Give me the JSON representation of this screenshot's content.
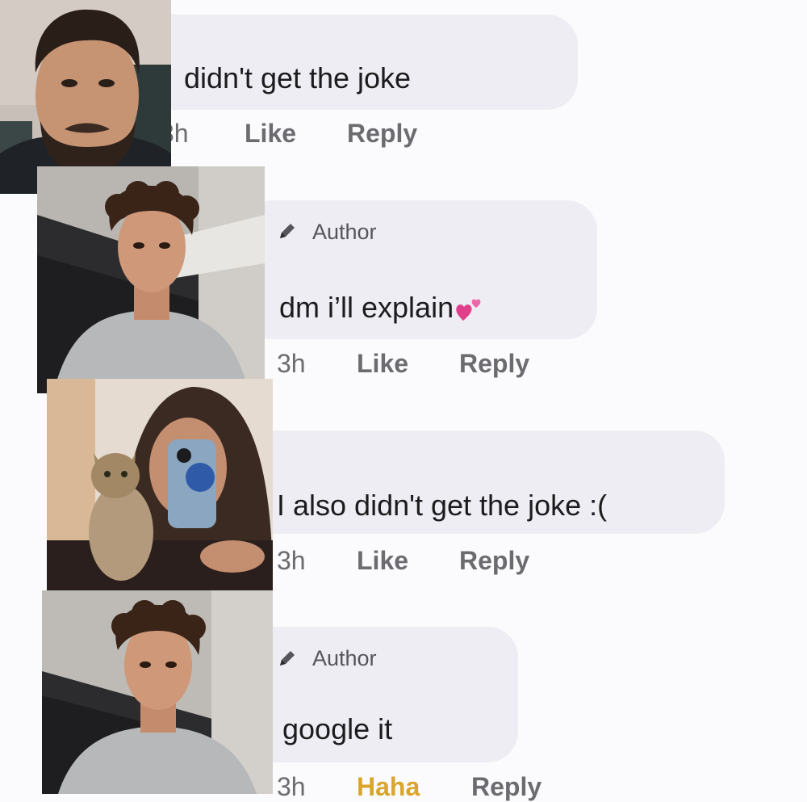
{
  "comments": [
    {
      "text": "didn't get the joke",
      "time": "3h",
      "actions": [
        "Like",
        "Reply"
      ],
      "is_author": false
    },
    {
      "text": "dm i’ll explain",
      "emoji": "two-hearts",
      "time": "3h",
      "actions": [
        "Like",
        "Reply"
      ],
      "is_author": true,
      "badge": "Author"
    },
    {
      "text": "I also didn't get the joke :(",
      "time": "3h",
      "actions": [
        "Like",
        "Reply"
      ],
      "is_author": false
    },
    {
      "text": "google it",
      "time": "3h",
      "actions": [
        "Haha",
        "Reply"
      ],
      "is_author": true,
      "badge": "Author"
    }
  ],
  "colors": {
    "bubble": "#eeedf3",
    "meta_text": "#6b6b70",
    "haha_reaction": "#d9a52b",
    "heart": "#e0408a",
    "background": "#fbfbfd"
  },
  "icons": [
    "pen-icon",
    "two-hearts-emoji"
  ]
}
